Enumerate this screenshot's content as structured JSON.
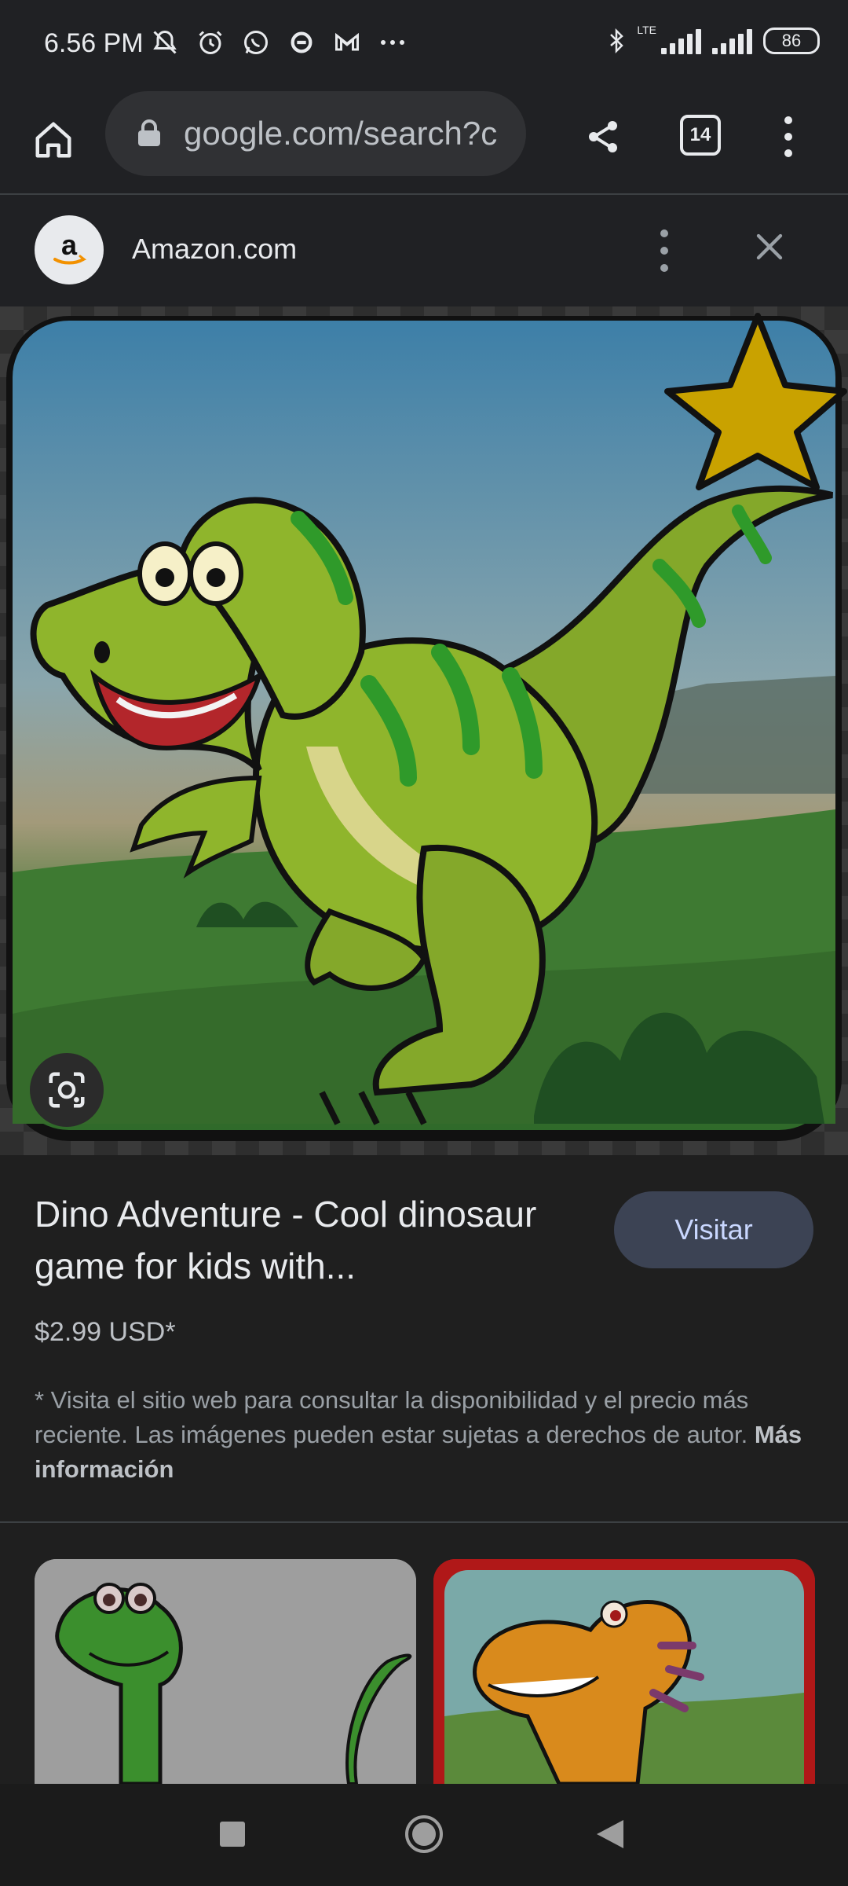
{
  "status_bar": {
    "time": "6.56 PM",
    "network": "LTE",
    "battery": "86",
    "icons": [
      "mute-bell-icon",
      "alarm-icon",
      "whatsapp-icon",
      "app-icon",
      "gmail-icon",
      "more-dots-icon",
      "bluetooth-icon",
      "signal-icon",
      "signal-icon",
      "battery-icon"
    ]
  },
  "browser": {
    "url": "google.com/search?c",
    "tab_count": "14"
  },
  "source": {
    "name": "Amazon.com",
    "logo_letter": "a"
  },
  "product": {
    "title": "Dino Adventure - Cool dinosaur game for kids with...",
    "price": "$2.99 USD*",
    "visit_label": "Visitar",
    "disclaimer": "* Visita el sitio web para consultar la disponibilidad y el precio más reciente. Las imágenes pueden estar sujetas a derechos de autor.",
    "more_info": "Más información"
  },
  "colors": {
    "background": "#1f1f1f",
    "toolbar": "#202124",
    "visit_button": "#3c4354",
    "dino_green": "#8cc63f",
    "star": "#f2c200"
  }
}
